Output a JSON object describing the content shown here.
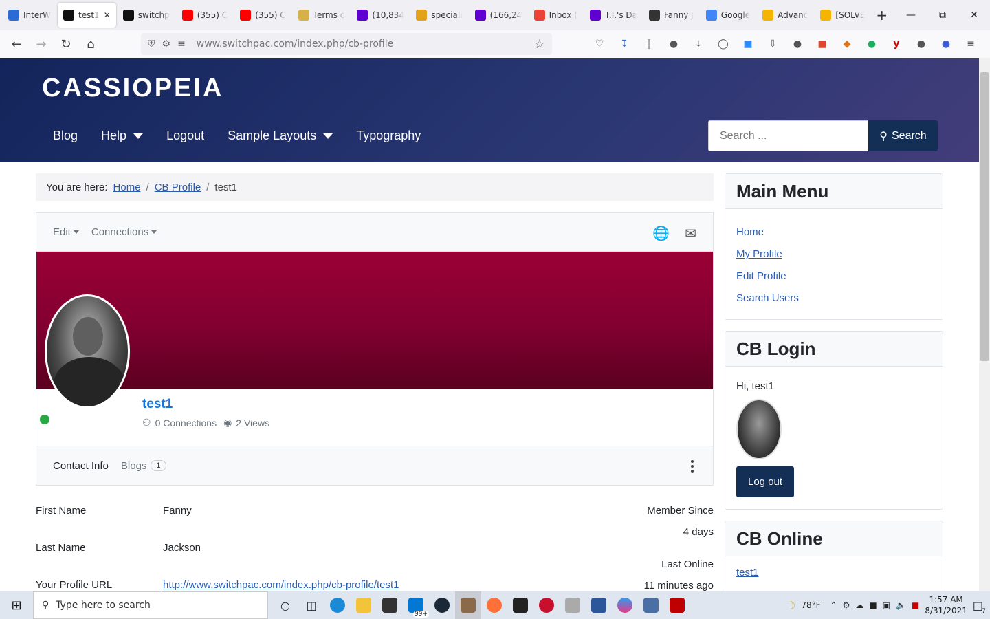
{
  "browser": {
    "tabs": [
      {
        "label": "InterW",
        "color": "#2b6cd4"
      },
      {
        "label": "test1",
        "color": "#111111",
        "active": true
      },
      {
        "label": "switchp",
        "color": "#111111"
      },
      {
        "label": "(355) C",
        "color": "#ff0000"
      },
      {
        "label": "(355) C",
        "color": "#ff0000"
      },
      {
        "label": "Terms c",
        "color": "#d6b14a"
      },
      {
        "label": "(10,834",
        "color": "#6001d2"
      },
      {
        "label": "speciali",
        "color": "#e4a11b"
      },
      {
        "label": "(166,24",
        "color": "#6001d2"
      },
      {
        "label": "Inbox (",
        "color": "#ea4335"
      },
      {
        "label": "T.I.'s Da",
        "color": "#6001d2"
      },
      {
        "label": "Fanny J",
        "color": "#333333"
      },
      {
        "label": "Google",
        "color": "#4285f4"
      },
      {
        "label": "Advanc",
        "color": "#f4b400"
      },
      {
        "label": "[SOLVE",
        "color": "#f4b400"
      }
    ],
    "new_tab_label": "+",
    "url": "www.switchpac.com/index.php/cb-profile"
  },
  "site": {
    "brand": "CASSIOPEIA",
    "nav": [
      {
        "label": "Blog",
        "dropdown": false
      },
      {
        "label": "Help",
        "dropdown": true
      },
      {
        "label": "Logout",
        "dropdown": false
      },
      {
        "label": "Sample Layouts",
        "dropdown": true
      },
      {
        "label": "Typography",
        "dropdown": false
      }
    ],
    "search_placeholder": "Search ...",
    "search_button": "Search"
  },
  "breadcrumb": {
    "prefix": "You are here:",
    "items": [
      "Home",
      "CB Profile",
      "test1"
    ]
  },
  "profile": {
    "menu_edit": "Edit",
    "menu_connections": "Connections",
    "username": "test1",
    "connections_text": "0 Connections",
    "views_text": "2 Views",
    "tab_contact": "Contact Info",
    "tab_blogs": "Blogs",
    "blogs_count": "1",
    "fields": [
      {
        "label": "First Name",
        "value": "Fanny"
      },
      {
        "label": "Last Name",
        "value": "Jackson"
      },
      {
        "label": "Your Profile URL",
        "value": "http://www.switchpac.com/index.php/cb-profile/test1"
      }
    ],
    "member_since_label": "Member Since",
    "member_since_value": "4 days",
    "last_online_label": "Last Online",
    "last_online_value": "11 minutes ago"
  },
  "sidebar": {
    "main_menu_title": "Main Menu",
    "main_menu": [
      "Home",
      "My Profile",
      "Edit Profile",
      "Search Users"
    ],
    "cb_login_title": "CB Login",
    "greeting": "Hi, test1",
    "logout_button": "Log out",
    "cb_online_title": "CB Online",
    "online_user": "test1"
  },
  "taskbar": {
    "search_placeholder": "Type here to search",
    "badge": "99+",
    "weather": "78°F",
    "time": "1:57 AM",
    "date": "8/31/2021",
    "notifications": "7"
  }
}
